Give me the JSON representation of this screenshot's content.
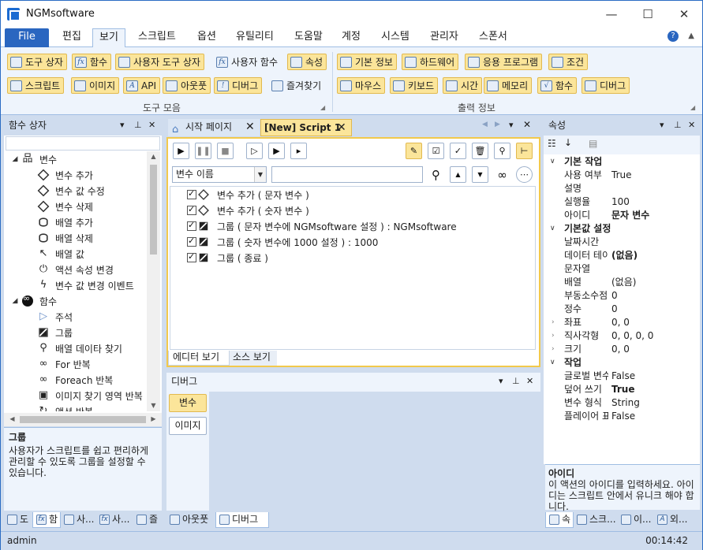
{
  "window": {
    "title": "NGMsoftware",
    "min_glyph": "—",
    "max_glyph": "☐",
    "close_glyph": "✕"
  },
  "menu": {
    "file": "File",
    "items": [
      "편집",
      "보기",
      "스크립트",
      "옵션",
      "유틸리티",
      "도움말",
      "계정",
      "시스템",
      "관리자",
      "스폰서"
    ],
    "active": "보기",
    "collapse_glyph": "▲",
    "help_glyph": "?"
  },
  "ribbon": {
    "tools_group": {
      "label": "도구 모음",
      "row1": [
        "도구 상자",
        "함수",
        "사용자 도구 상자",
        "사용자 함수",
        "속성"
      ],
      "row2": [
        "스크립트",
        "이미지",
        "API",
        "아웃풋",
        "디버그",
        "즐겨찾기"
      ]
    },
    "output_group": {
      "label": "출력 정보",
      "row1": [
        "기본 정보",
        "하드웨어",
        "응용 프로그램",
        "조건"
      ],
      "row2": [
        "마우스",
        "키보드",
        "시간",
        "메모리",
        "함수",
        "디버그"
      ]
    }
  },
  "toolbox": {
    "title": "함수 상자",
    "categories": [
      {
        "label": "변수",
        "items": [
          "변수 추가",
          "변수 값 수정",
          "변수 삭제",
          "배열 추가",
          "배열 삭제",
          "배열 값",
          "액션 속성 변경",
          "변수 값 변경 이벤트"
        ]
      },
      {
        "label": "함수",
        "items": [
          "주석",
          "그룹",
          "배열 데이타 찾기",
          "For 반복",
          "Foreach 반복",
          "이미지 찾기 영역 반복",
          "액션 반복"
        ]
      }
    ],
    "desc_title": "그룹",
    "desc_text": "사용자가 스크립트를 쉽고 편리하게 관리할 수 있도록 그룹을 설정할 수 있습니다.",
    "bottom_tabs": [
      "도",
      "함",
      "사...",
      "사...",
      "즐"
    ]
  },
  "editor": {
    "tabs": [
      {
        "label": "시작 페이지"
      },
      {
        "label": "[New] Script 1"
      }
    ],
    "var_combo": "변수 이름",
    "search_value": "",
    "rows": [
      "변수 추가 ( 문자 변수 )",
      "변수 추가 ( 숫자 변수 )",
      "그룹 ( 문자 변수에 NGMsoftware 설정 ) : NGMsoftware",
      "그룹 ( 숫자 변수에 1000 설정 ) : 1000",
      "그룹 ( 종료 )"
    ],
    "view_tabs": [
      "에디터 보기",
      "소스 보기"
    ]
  },
  "debugger": {
    "title": "디버그",
    "buttons": [
      "변수",
      "이미지"
    ],
    "bottom_tabs": [
      "아웃풋",
      "디버그"
    ]
  },
  "properties": {
    "title": "속성",
    "sections": [
      {
        "name": "기본 작업",
        "rows": [
          {
            "name": "사용 여부",
            "value": "True",
            "bold": false
          },
          {
            "name": "설명",
            "value": "",
            "bold": false
          },
          {
            "name": "실행율",
            "value": "100",
            "bold": false
          },
          {
            "name": "아이디",
            "value": "문자 변수",
            "bold": true
          }
        ]
      },
      {
        "name": "기본값 설정",
        "rows": [
          {
            "name": "날짜시간",
            "value": "",
            "bold": false
          },
          {
            "name": "데이터 테이블",
            "value": "(없음)",
            "bold": true
          },
          {
            "name": "문자열",
            "value": "",
            "bold": false
          },
          {
            "name": "배열",
            "value": "(없음)",
            "bold": false
          },
          {
            "name": "부동소수점",
            "value": "0",
            "bold": false
          },
          {
            "name": "정수",
            "value": "0",
            "bold": false
          },
          {
            "name": "좌표",
            "value": "0, 0",
            "bold": false
          },
          {
            "name": "직사각형",
            "value": "0, 0, 0, 0",
            "bold": false
          },
          {
            "name": "크기",
            "value": "0, 0",
            "bold": false
          }
        ]
      },
      {
        "name": "작업",
        "rows": [
          {
            "name": "글로벌 변수",
            "value": "False",
            "bold": false
          },
          {
            "name": "덮어 쓰기",
            "value": "True",
            "bold": true
          },
          {
            "name": "변수 형식",
            "value": "String",
            "bold": false
          },
          {
            "name": "플레이어 표시",
            "value": "False",
            "bold": false
          }
        ]
      }
    ],
    "desc_title": "아이디",
    "desc_text": "이 액션의 아이디를 입력하세요. 아이디는 스크립트 안에서 유니크 해야 합니다.",
    "bottom_tabs": [
      "속",
      "스크...",
      "이...",
      "외..."
    ]
  },
  "status": {
    "user": "admin",
    "time": "00:14:42"
  }
}
